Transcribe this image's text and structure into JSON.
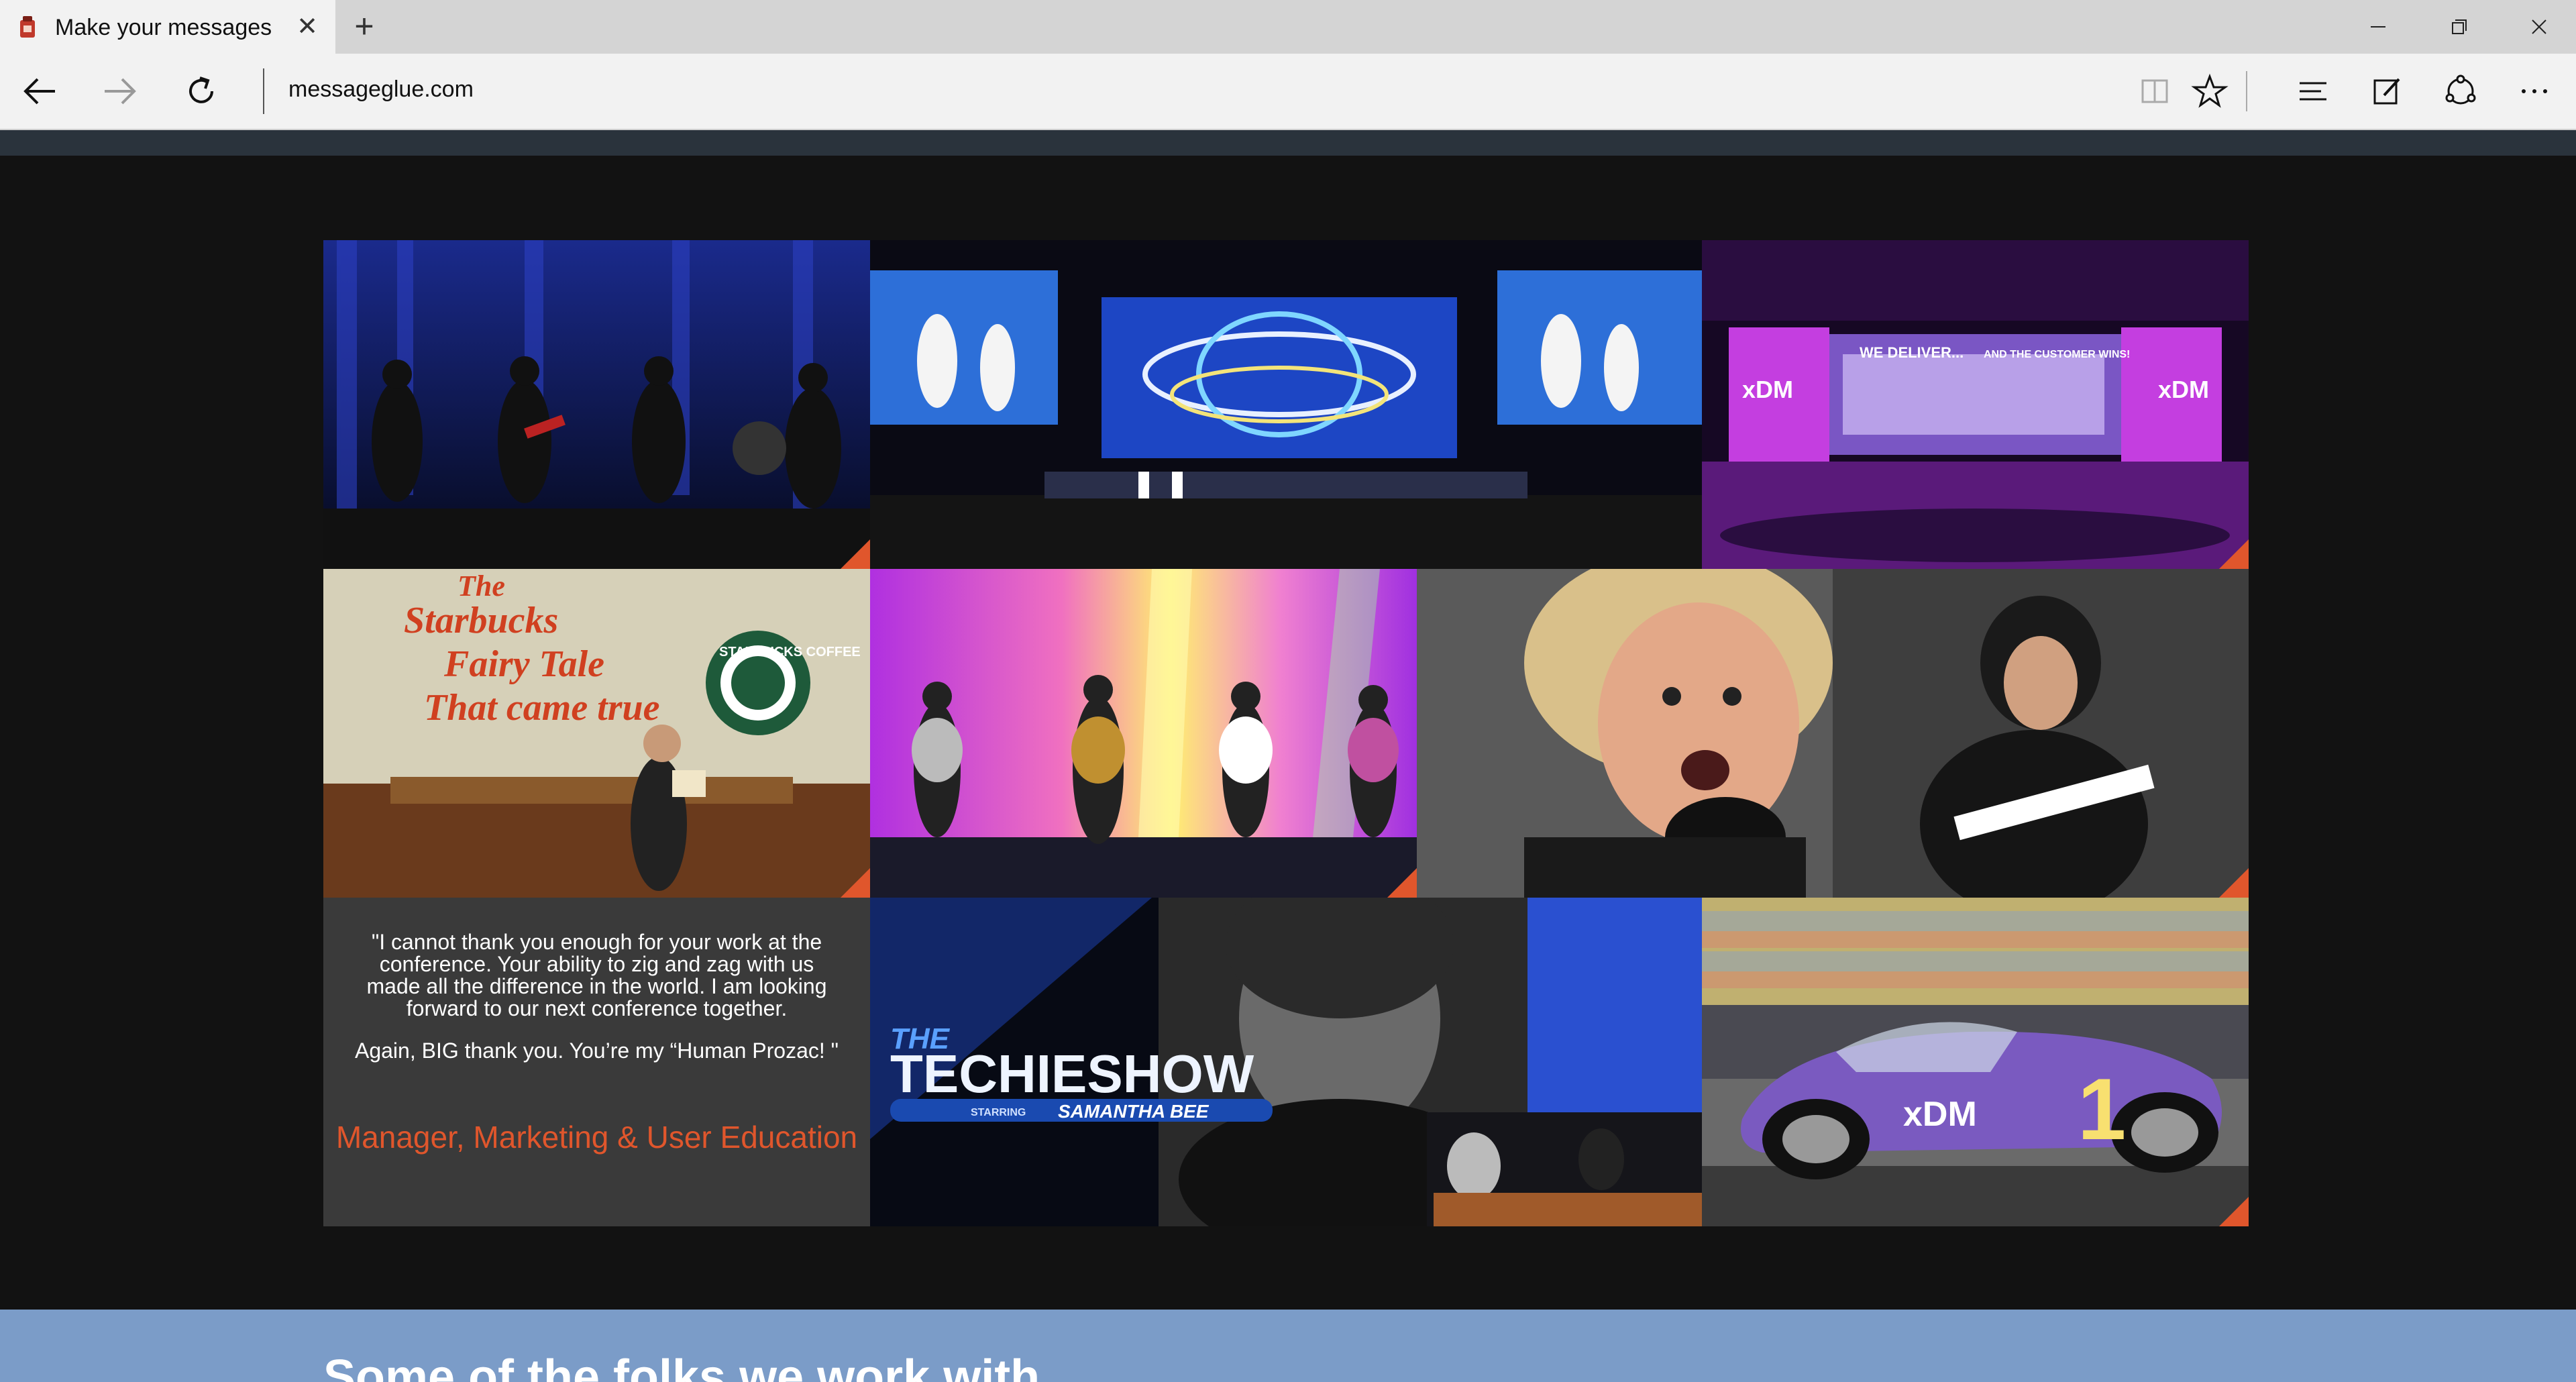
{
  "browser": {
    "tab_title": "Make your messages sti",
    "new_tab_label": "+",
    "url": "messageglue.com",
    "window_buttons": [
      "minimize",
      "restore",
      "close"
    ],
    "toolbar_icons": [
      "reading-view-icon",
      "favorites-star-icon",
      "hub-icon",
      "web-note-icon",
      "share-icon",
      "more-icon"
    ]
  },
  "gallery": {
    "items": [
      {
        "name": "band-performance-photo"
      },
      {
        "name": "conference-stage-photo"
      },
      {
        "name": "xdm-stage-photo",
        "text_1": "WE DELIVER...",
        "text_2": "AND THE CUSTOMER WINS!",
        "logo": "xDM"
      },
      {
        "name": "starbucks-fairy-tale-photo",
        "lines": [
          "The",
          "Starbucks",
          "Fairy Tale",
          "That came true"
        ],
        "logo": "STARBUCKS COFFEE"
      },
      {
        "name": "dancers-photo"
      },
      {
        "name": "singer-guitarist-photo"
      },
      {
        "name": "techie-show-photo",
        "show_title_1": "THE",
        "show_title_2": "TECHIESHOW",
        "starring": "STARRING",
        "host": "SAMANTHA BEE"
      },
      {
        "name": "race-car-photo",
        "car_logo": "xDM",
        "number": "1"
      }
    ],
    "testimonial": {
      "paragraph_1": "\"I cannot thank you enough for your work at the conference. Your ability to zig and zag with us made all the difference in the world. I am looking forward to our next conference together.",
      "paragraph_2": "Again, BIG thank you. You’re my “Human Prozac! \"",
      "author": "Manager, Marketing & User Education"
    }
  },
  "next_section": {
    "title": "Some of the folks we work with"
  },
  "colors": {
    "accent": "#e0562c",
    "band": "#7b9cc8",
    "page_bg": "#121212",
    "topbar": "#2a333c"
  }
}
